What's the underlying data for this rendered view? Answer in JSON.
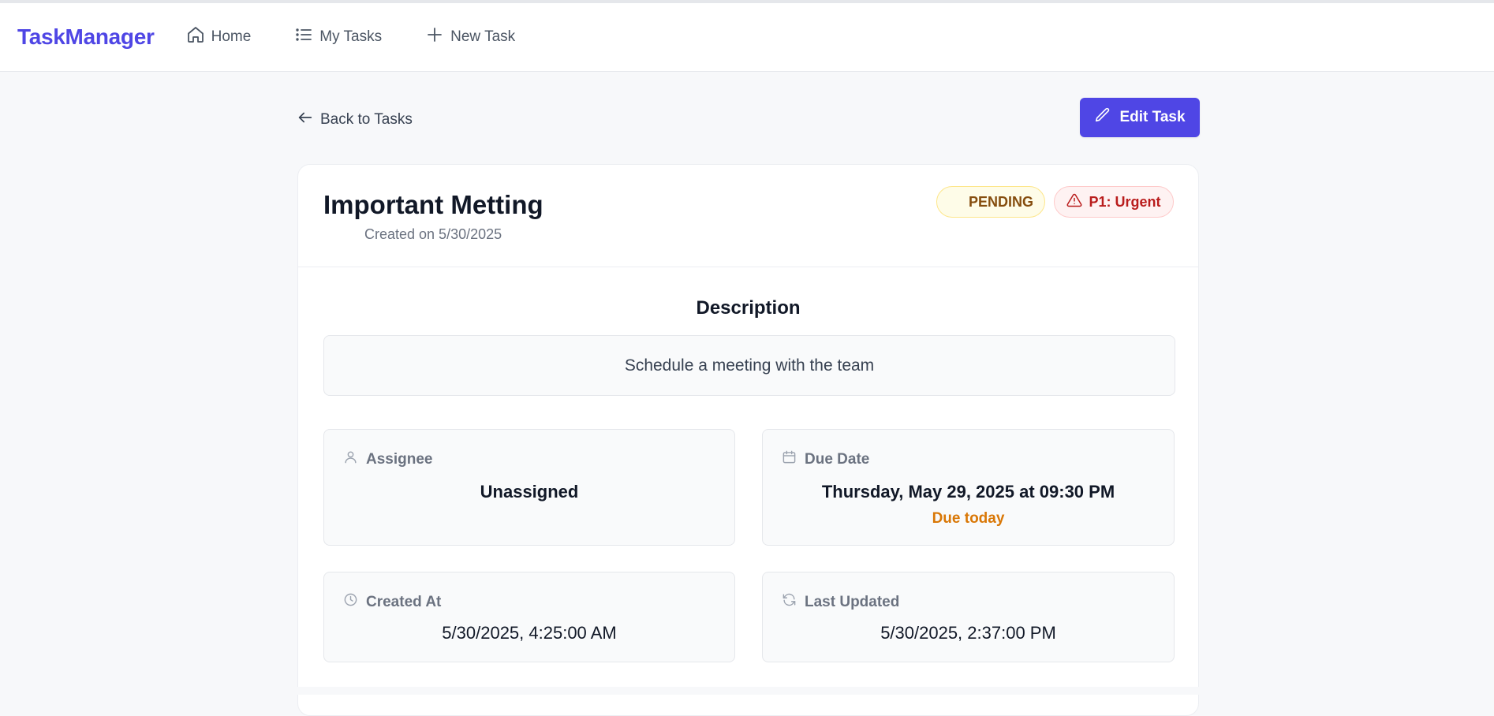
{
  "nav": {
    "brand": "TaskManager",
    "items": [
      {
        "label": "Home",
        "icon": "home-icon"
      },
      {
        "label": "My Tasks",
        "icon": "list-icon"
      },
      {
        "label": "New Task",
        "icon": "plus-icon"
      }
    ]
  },
  "toolbar": {
    "back_label": "Back to Tasks",
    "edit_label": "Edit Task"
  },
  "task": {
    "title": "Important Metting",
    "created_on": "Created on 5/30/2025",
    "status": "PENDING",
    "priority": "P1: Urgent",
    "description_heading": "Description",
    "description": "Schedule a meeting with the team"
  },
  "details": {
    "assignee_label": "Assignee",
    "assignee_value": "Unassigned",
    "due_label": "Due Date",
    "due_value": "Thursday, May 29, 2025 at 09:30 PM",
    "due_note": "Due today",
    "created_label": "Created At",
    "created_value": "5/30/2025, 4:25:00 AM",
    "updated_label": "Last Updated",
    "updated_value": "5/30/2025, 2:37:00 PM"
  },
  "colors": {
    "brand": "#4f46e5",
    "status_bg": "#fefce8",
    "status_text": "#854d0e",
    "priority_bg": "#fef2f2",
    "priority_text": "#b91c1c",
    "due_note": "#d97706"
  }
}
